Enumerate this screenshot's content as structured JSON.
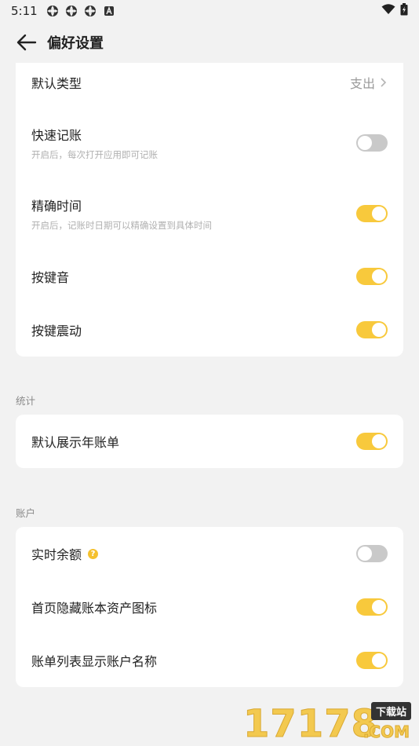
{
  "status_bar": {
    "time": "5:11",
    "icons": [
      "app-notification-icon",
      "app-notification-icon",
      "app-notification-icon",
      "text-a-icon"
    ],
    "right_icons": [
      "wifi-icon",
      "battery-charging-icon"
    ]
  },
  "header": {
    "title": "偏好设置"
  },
  "general": {
    "default_type": {
      "label": "默认类型",
      "value": "支出"
    },
    "quick_record": {
      "label": "快速记账",
      "desc": "开启后，每次打开应用即可记账",
      "on": false
    },
    "precise_time": {
      "label": "精确时间",
      "desc": "开启后，记账时日期可以精确设置到具体时间",
      "on": true
    },
    "key_sound": {
      "label": "按键音",
      "on": true
    },
    "key_vibration": {
      "label": "按键震动",
      "on": true
    }
  },
  "stats": {
    "section_label": "统计",
    "default_year_bill": {
      "label": "默认展示年账单",
      "on": true
    }
  },
  "account": {
    "section_label": "账户",
    "realtime_balance": {
      "label": "实时余额",
      "on": false
    },
    "hide_assets_icon": {
      "label": "首页隐藏账本资产图标",
      "on": true
    },
    "show_account_name": {
      "label": "账单列表显示账户名称",
      "on": true
    }
  },
  "watermark": {
    "digits": "17178",
    "tag": "下载站",
    "suffix": ".COM"
  },
  "colors": {
    "accent": "#f8c93c",
    "toggle_off": "#c9c9c9",
    "background": "#f2f2f2",
    "card": "#ffffff"
  }
}
